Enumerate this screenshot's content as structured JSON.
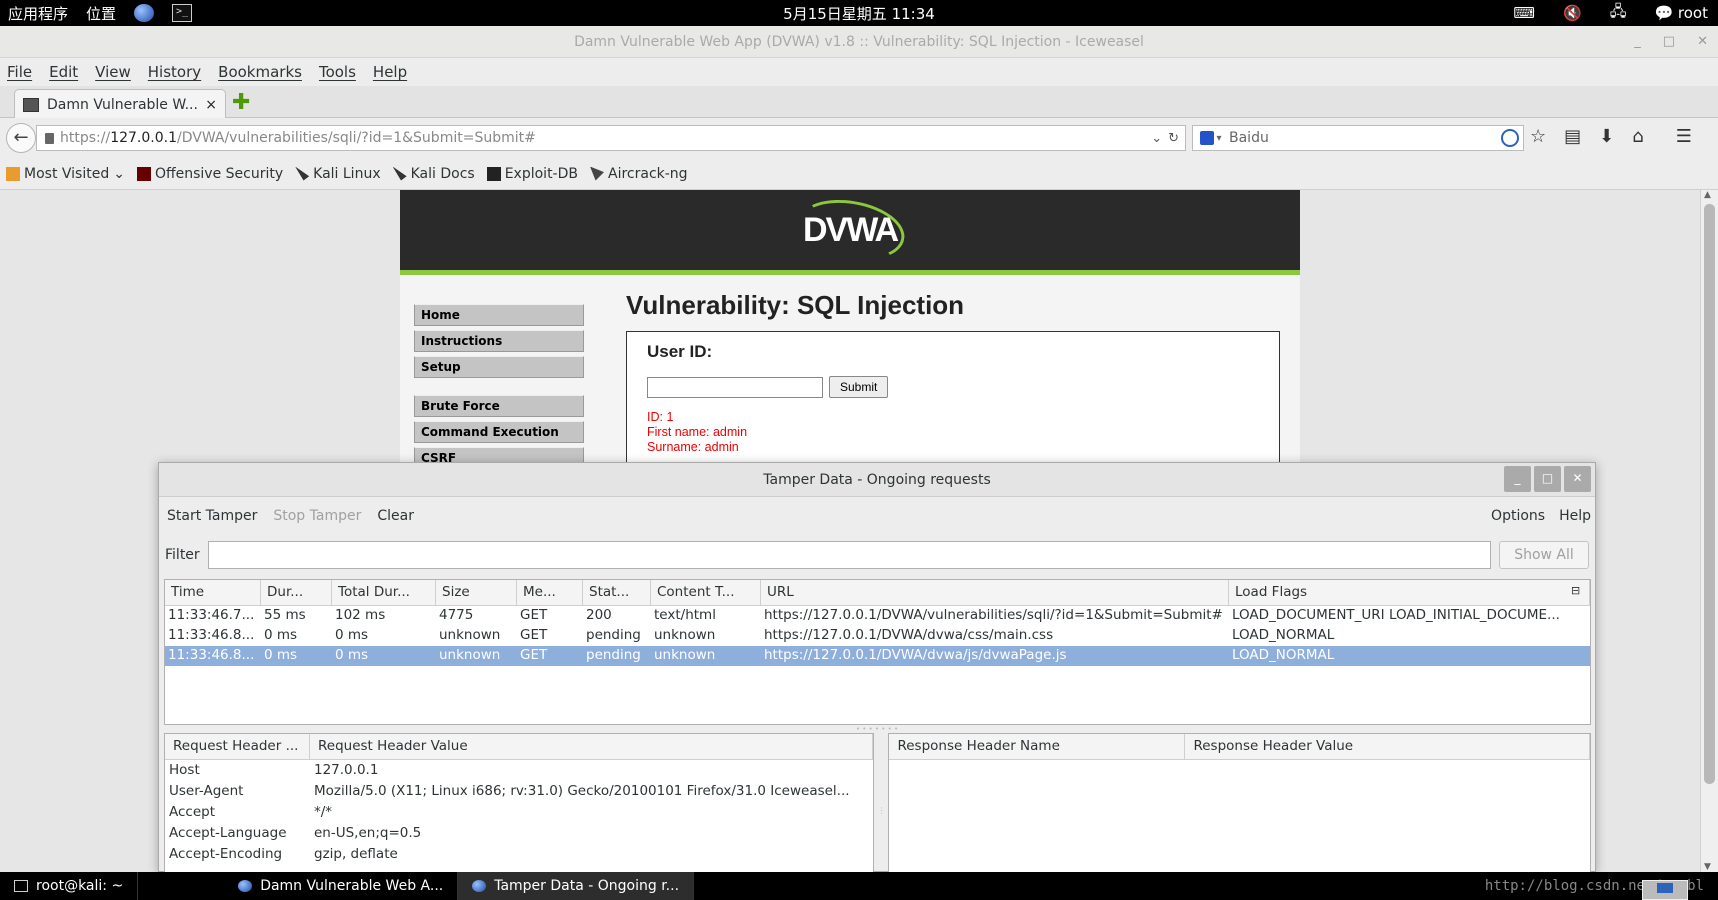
{
  "top_panel": {
    "apps_label": "应用程序",
    "places_label": "位置",
    "clock": "5月15日星期五 11:34",
    "user": "root"
  },
  "window": {
    "title": "Damn Vulnerable Web App (DVWA) v1.8 :: Vulnerability: SQL Injection - Iceweasel"
  },
  "menu": [
    "File",
    "Edit",
    "View",
    "History",
    "Bookmarks",
    "Tools",
    "Help"
  ],
  "tab": {
    "title": "Damn Vulnerable W...",
    "close": "×"
  },
  "url": {
    "scheme": "https://",
    "host": "127.0.0.1",
    "path": "/DVWA/vulnerabilities/sqli/?id=1&Submit=Submit#"
  },
  "search": {
    "placeholder": "Baidu"
  },
  "bookmarks": [
    "Most Visited",
    "Offensive Security",
    "Kali Linux",
    "Kali Docs",
    "Exploit-DB",
    "Aircrack-ng"
  ],
  "dvwa": {
    "logo": "DVWA",
    "menu": [
      "Home",
      "Instructions",
      "Setup",
      "Brute Force",
      "Command Execution",
      "CSRF"
    ],
    "page_title": "Vulnerability: SQL Injection",
    "user_id_label": "User ID:",
    "submit_label": "Submit",
    "result": [
      "ID: 1",
      "First name: admin",
      "Surname: admin"
    ]
  },
  "tamper": {
    "title": "Tamper Data - Ongoing requests",
    "start": "Start Tamper",
    "stop": "Stop Tamper",
    "clear": "Clear",
    "options": "Options",
    "help": "Help",
    "filter_label": "Filter",
    "show_all": "Show All",
    "columns": [
      "Time",
      "Dur...",
      "Total Dur...",
      "Size",
      "Me...",
      "Stat...",
      "Content T...",
      "URL",
      "Load Flags"
    ],
    "rows": [
      [
        "11:33:46.7...",
        "55 ms",
        "102 ms",
        "4775",
        "GET",
        "200",
        "text/html",
        "https://127.0.0.1/DVWA/vulnerabilities/sqli/?id=1&Submit=Submit#",
        "LOAD_DOCUMENT_URI  LOAD_INITIAL_DOCUME..."
      ],
      [
        "11:33:46.8...",
        "0 ms",
        "0 ms",
        "unknown",
        "GET",
        "pending",
        "unknown",
        "https://127.0.0.1/DVWA/dvwa/css/main.css",
        "LOAD_NORMAL"
      ],
      [
        "11:33:46.8...",
        "0 ms",
        "0 ms",
        "unknown",
        "GET",
        "pending",
        "unknown",
        "https://127.0.0.1/DVWA/dvwa/js/dvwaPage.js",
        "LOAD_NORMAL"
      ]
    ],
    "req_header_cols": [
      "Request Header ...",
      "Request Header Value"
    ],
    "req_headers": [
      [
        "Host",
        "127.0.0.1"
      ],
      [
        "User-Agent",
        "Mozilla/5.0 (X11; Linux i686; rv:31.0) Gecko/20100101 Firefox/31.0 Iceweasel..."
      ],
      [
        "Accept",
        "*/*"
      ],
      [
        "Accept-Language",
        "en-US,en;q=0.5"
      ],
      [
        "Accept-Encoding",
        "gzip, deflate"
      ]
    ],
    "resp_header_cols": [
      "Response Header Name",
      "Response Header Value"
    ]
  },
  "taskbar": {
    "items": [
      "root@kali: ~",
      "Damn Vulnerable Web A...",
      "Tamper Data - Ongoing r..."
    ],
    "watermark": "http://blog.csdn.net/youbl"
  }
}
